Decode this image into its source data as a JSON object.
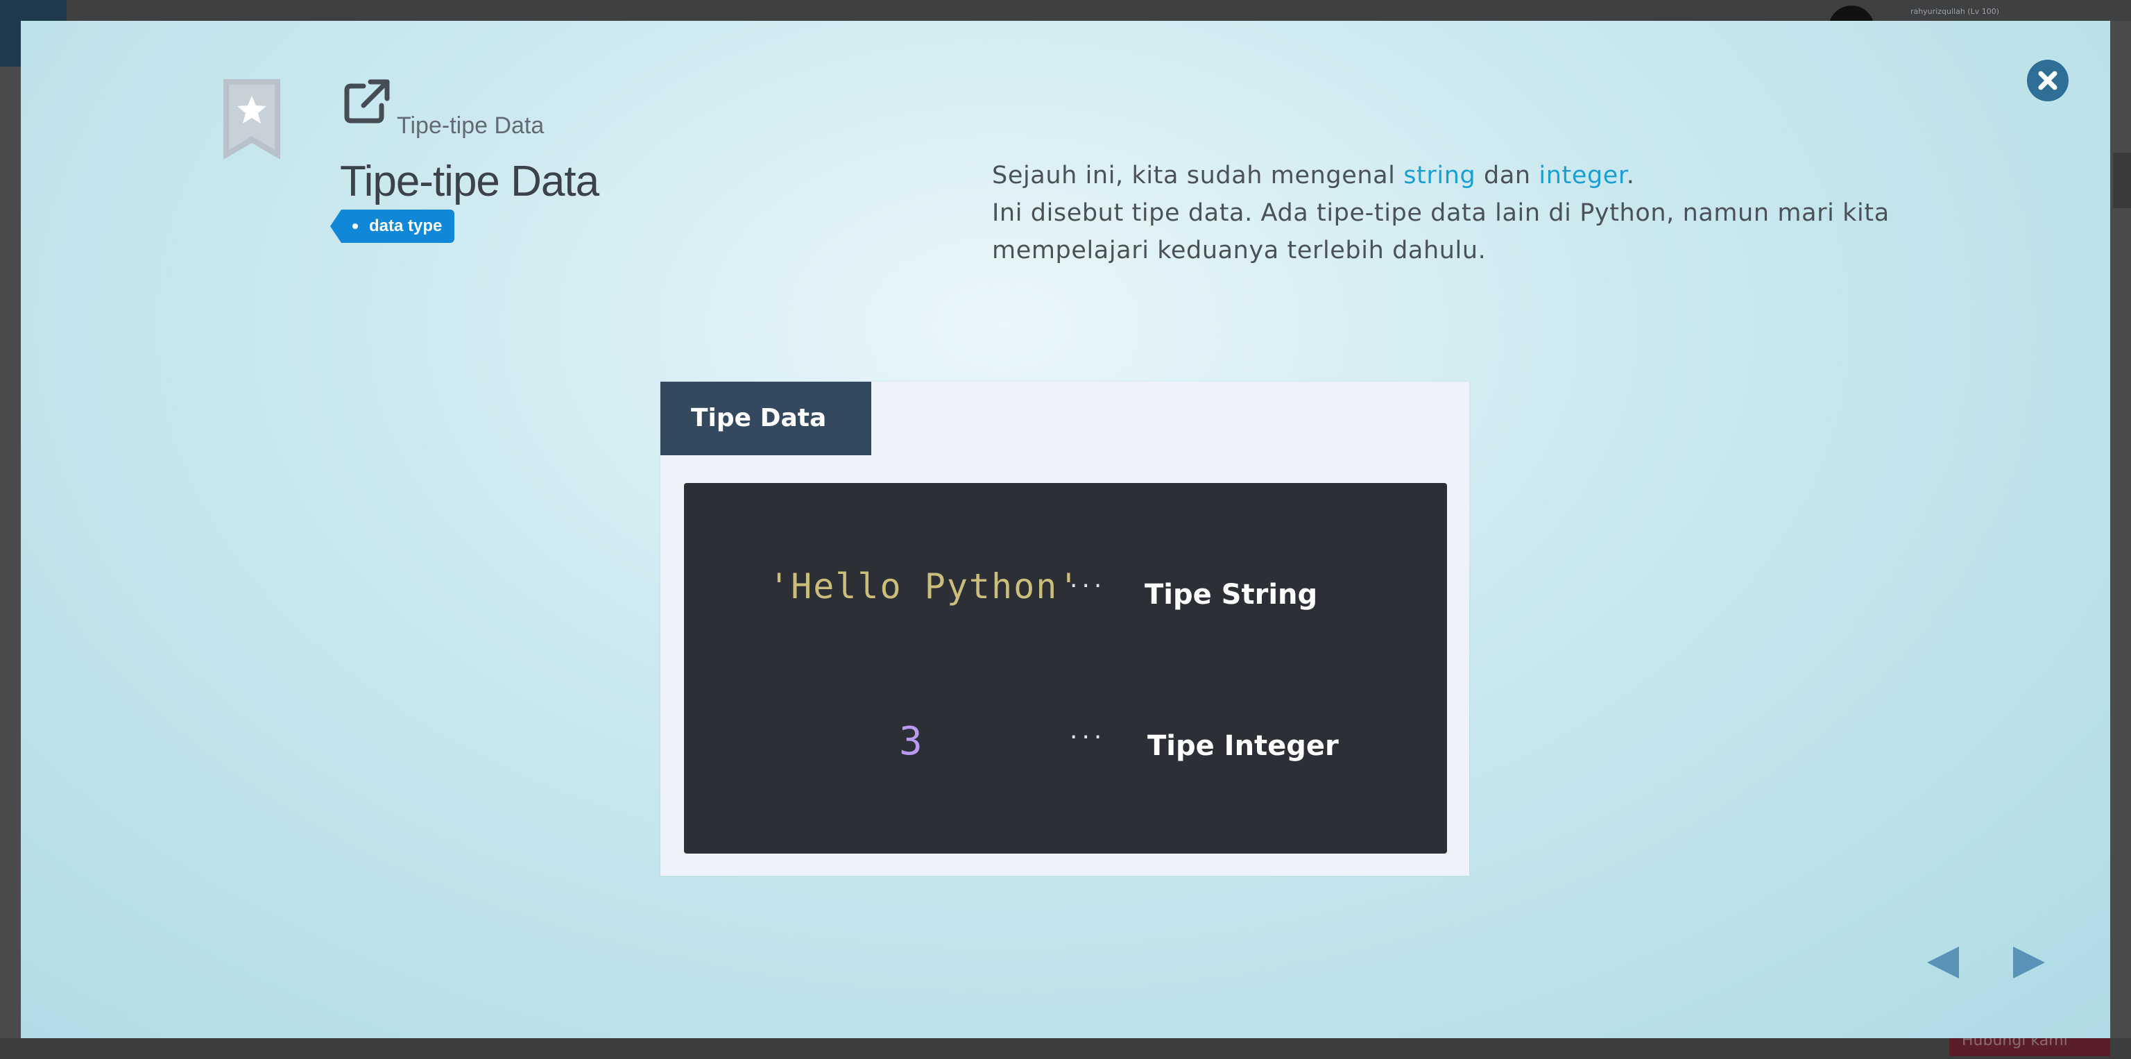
{
  "background": {
    "user_label": "rahyurizqullah (Lv 100)",
    "hint_label": "Hubungi kami"
  },
  "modal": {
    "breadcrumb": "Tipe-tipe Data",
    "title": "Tipe-tipe Data",
    "tag": "data type",
    "description": {
      "line1_pre": "Sejauh ini, kita sudah mengenal ",
      "kw_string": "string",
      "line1_mid": " dan ",
      "kw_integer": "integer",
      "line1_end": ".",
      "line2": "Ini disebut tipe data. Ada tipe-tipe data lain di Python, namun mari kita",
      "line3": "mempelajari keduanya terlebih dahulu."
    },
    "slide": {
      "header": "Tipe Data",
      "string_example": "'Hello Python'",
      "integer_example": "3",
      "dots": "···",
      "string_type_label": "Tipe String",
      "integer_type_label": "Tipe Integer"
    }
  },
  "colors": {
    "accent": "#1a9fd4",
    "close_button": "#2e6e97",
    "tag_bg": "#1187d7",
    "slide_header_bg": "#34495e",
    "code_bg": "#2c2f36",
    "string_literal": "#cbbd7b",
    "integer_literal": "#b99af0",
    "nav_arrow": "#5a93b8"
  },
  "icons": {
    "close": "close-icon",
    "bookmark": "bookmark-star-icon",
    "external": "external-link-icon",
    "prev": "arrow-left-icon",
    "next": "arrow-right-icon"
  }
}
